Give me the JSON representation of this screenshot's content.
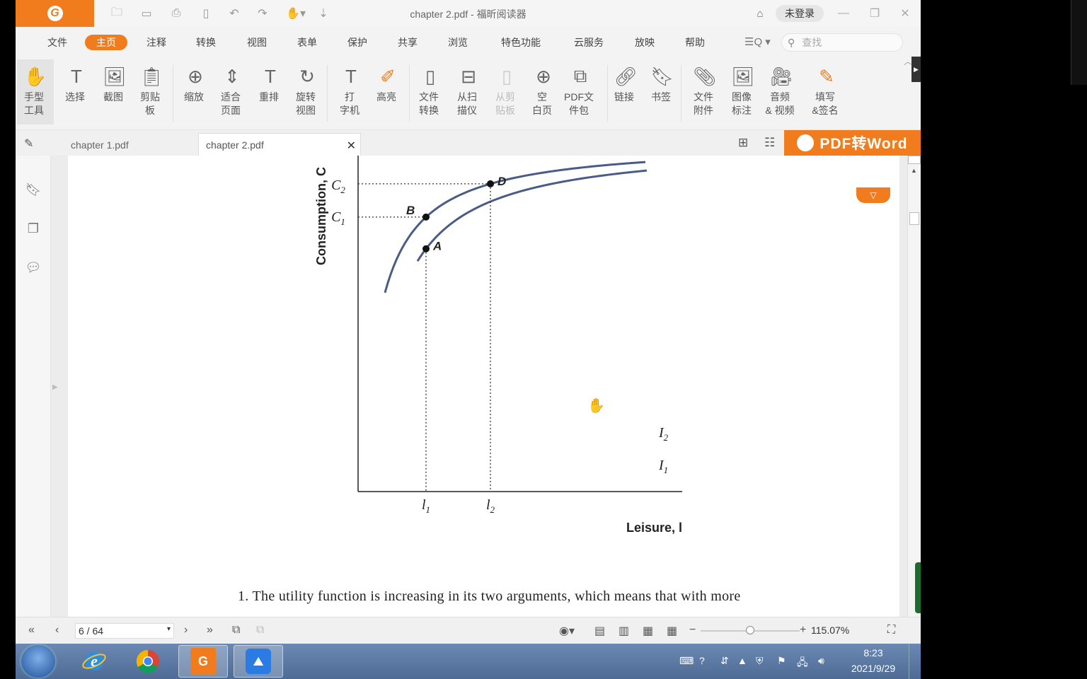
{
  "window": {
    "title": "chapter 2.pdf - 福昕阅读器",
    "login_label": "未登录"
  },
  "menu": {
    "items": [
      "文件",
      "主页",
      "注释",
      "转换",
      "视图",
      "表单",
      "保护",
      "共享",
      "浏览",
      "特色功能",
      "云服务",
      "放映",
      "帮助"
    ],
    "active": "主页",
    "search_placeholder": "查找"
  },
  "ribbon": {
    "tools": [
      {
        "label": "手型\n工具",
        "icon": "hand-icon"
      },
      {
        "label": "选择",
        "icon": "select-text-icon"
      },
      {
        "label": "截图",
        "icon": "snapshot-icon"
      },
      {
        "label": "剪贴\n板",
        "icon": "clipboard-icon"
      },
      {
        "label": "缩放",
        "icon": "zoom-icon"
      },
      {
        "label": "适合\n页面",
        "icon": "fit-page-icon"
      },
      {
        "label": "重排",
        "icon": "reflow-icon"
      },
      {
        "label": "旋转\n视图",
        "icon": "rotate-view-icon"
      },
      {
        "label": "打\n字机",
        "icon": "typewriter-icon"
      },
      {
        "label": "高亮",
        "icon": "highlight-icon"
      },
      {
        "label": "文件\n转换",
        "icon": "file-convert-icon"
      },
      {
        "label": "从扫\n描仪",
        "icon": "scanner-icon"
      },
      {
        "label": "从剪\n贴板",
        "icon": "from-clipboard-icon"
      },
      {
        "label": "空\n白页",
        "icon": "blank-page-icon"
      },
      {
        "label": "PDF文\n件包",
        "icon": "pdf-package-icon"
      },
      {
        "label": "链接",
        "icon": "link-icon"
      },
      {
        "label": "书签",
        "icon": "bookmark-icon"
      },
      {
        "label": "文件\n附件",
        "icon": "attachment-icon"
      },
      {
        "label": "图像\n标注",
        "icon": "image-annotation-icon"
      },
      {
        "label": "音频\n& 视频",
        "icon": "audio-video-icon"
      },
      {
        "label": "填写\n&签名",
        "icon": "fill-sign-icon"
      }
    ]
  },
  "tabs": [
    {
      "label": "chapter 1.pdf"
    },
    {
      "label": "chapter 2.pdf"
    }
  ],
  "promo": {
    "label": "PDF转Word"
  },
  "document": {
    "chart_data": {
      "type": "line",
      "xlabel": "Leisure, l",
      "ylabel": "Consumption, C",
      "x_ticks": [
        "l1",
        "l2"
      ],
      "y_ticks": [
        "C1",
        "C2"
      ],
      "points": [
        {
          "label": "A",
          "curve": "I2"
        },
        {
          "label": "B",
          "curve": "I1",
          "x": "l1",
          "y": "C1"
        },
        {
          "label": "D",
          "curve": "I1",
          "x": "l2",
          "y": "C2"
        }
      ],
      "series": [
        {
          "name": "I1",
          "shape": "indifference curve (lower)"
        },
        {
          "name": "I2",
          "shape": "indifference curve (higher)"
        }
      ],
      "color": "#4a5b85"
    },
    "paragraph": "1.  The utility function is increasing in its two arguments, which means that with more"
  },
  "status": {
    "page": "6 / 64",
    "zoom": "115.07%"
  },
  "taskbar": {
    "time": "8:23",
    "date": "2021/9/29"
  }
}
